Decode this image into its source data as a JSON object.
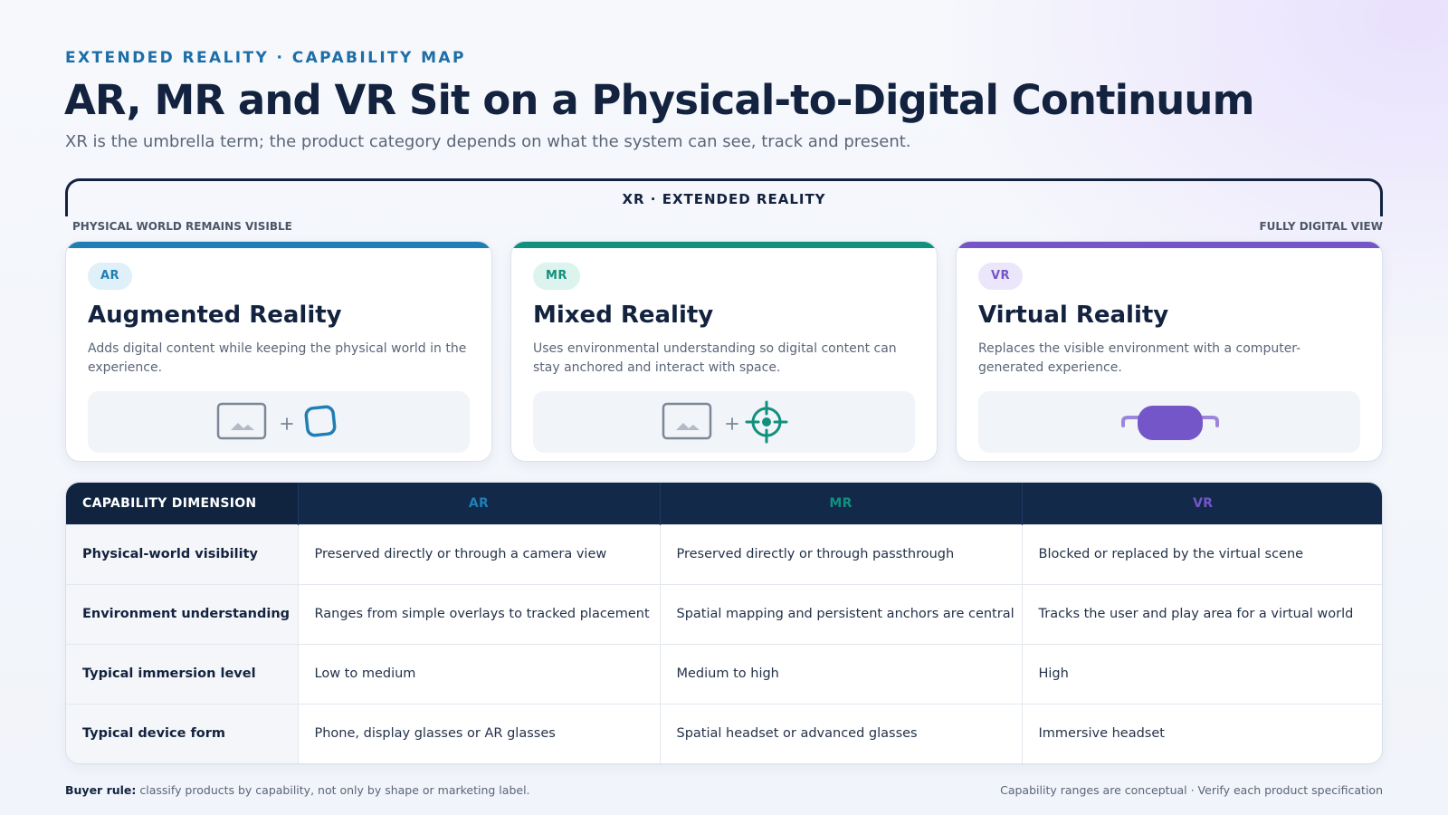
{
  "header": {
    "eyebrow": "EXTENDED REALITY · CAPABILITY MAP",
    "title": "AR, MR and VR Sit on a Physical-to-Digital Continuum",
    "subtitle": "XR is the umbrella term; the product category depends on what the system can see, track and present."
  },
  "continuum": {
    "umbrella_label": "XR · EXTENDED REALITY",
    "left_end": "PHYSICAL WORLD REMAINS VISIBLE",
    "right_end": "FULLY DIGITAL VIEW"
  },
  "cards": [
    {
      "badge": "AR",
      "title": "Augmented Reality",
      "description": "Adds digital content while keeping the physical world in the experience.",
      "accent": "#1f7fb5",
      "badge_bg": "#dff0f8",
      "illustration": [
        "image-frame-icon",
        "plus-icon",
        "rounded-square-icon"
      ]
    },
    {
      "badge": "MR",
      "title": "Mixed Reality",
      "description": "Uses environmental understanding so digital content can stay anchored and interact with space.",
      "accent": "#12907e",
      "badge_bg": "#dcf3ee",
      "illustration": [
        "image-frame-icon",
        "plus-icon",
        "crosshair-icon"
      ]
    },
    {
      "badge": "VR",
      "title": "Virtual Reality",
      "description": "Replaces the visible environment with a computer-generated experience.",
      "accent": "#7456c8",
      "badge_bg": "#ece6fa",
      "illustration": [
        "vr-headset-icon"
      ]
    }
  ],
  "table": {
    "headers": [
      "CAPABILITY DIMENSION",
      "AR",
      "MR",
      "VR"
    ],
    "header_colors": [
      "#ffffff",
      "#1f7fb5",
      "#12907e",
      "#7456c8"
    ],
    "rows": [
      {
        "dimension": "Physical-world visibility",
        "ar": "Preserved directly or through a camera view",
        "mr": "Preserved directly or through passthrough",
        "vr": "Blocked or replaced by the virtual scene"
      },
      {
        "dimension": "Environment understanding",
        "ar": "Ranges from simple overlays to tracked placement",
        "mr": "Spatial mapping and persistent anchors are central",
        "vr": "Tracks the user and play area for a virtual world"
      },
      {
        "dimension": "Typical immersion level",
        "ar": "Low to medium",
        "mr": "Medium to high",
        "vr": "High"
      },
      {
        "dimension": "Typical device form",
        "ar": "Phone, display glasses or AR glasses",
        "mr": "Spatial headset or advanced glasses",
        "vr": "Immersive headset"
      }
    ]
  },
  "footer": {
    "rule_label": "Buyer rule:",
    "rule_text": " classify products by capability, not only by shape or marketing label.",
    "note": "Capability ranges are conceptual · Verify each product specification"
  }
}
